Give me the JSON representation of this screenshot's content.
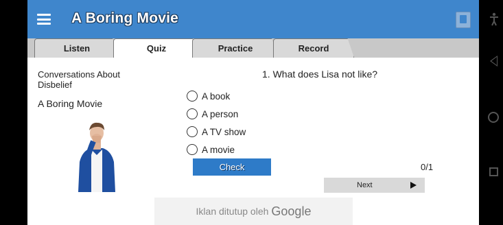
{
  "app": {
    "title": "A Boring Movie",
    "menu_icon": "hamburger-menu-icon",
    "book_icon": "book-icon"
  },
  "tabs": [
    {
      "label": "Listen",
      "active": false
    },
    {
      "label": "Quiz",
      "active": true
    },
    {
      "label": "Practice",
      "active": false
    },
    {
      "label": "Record",
      "active": false
    }
  ],
  "lesson": {
    "category": "Conversations About Disbelief",
    "name": "A Boring Movie"
  },
  "quiz": {
    "question": "1. What does Lisa not like?",
    "options": [
      "A book",
      "A person",
      "A TV show",
      "A movie"
    ],
    "check_label": "Check",
    "score": "0/1",
    "next_label": "Next"
  },
  "ad": {
    "text": "Iklan ditutup oleh",
    "brand": "Google"
  },
  "colors": {
    "appbar": "#3f86cc",
    "check_button": "#2e7bc8",
    "tabbar": "#c8c8c8"
  }
}
